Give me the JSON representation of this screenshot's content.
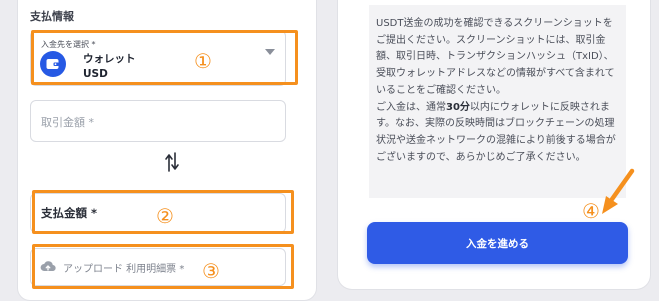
{
  "payment": {
    "section_title": "支払情報",
    "deposit_destination": {
      "caption": "入金先を選択 *",
      "wallet_name": "ウォレット",
      "currency": "USD"
    },
    "trade_amount_placeholder": "取引金額 *",
    "payment_amount_label": "支払金額 *",
    "upload_label": "アップロード 利用明細票 *"
  },
  "annotations": {
    "marker_1": "①",
    "marker_2": "②",
    "marker_3": "③",
    "marker_4": "④",
    "highlight_color": "#f5901e"
  },
  "notice": {
    "paragraph_1": "USDT送金の成功を確認できるスクリーンショットをご提出ください。スクリーンショットには、取引金額、取引日時、トランザクションハッシュ（TxID）、受取ウォレットアドレスなどの情報がすべて含まれていることをご確認ください。",
    "paragraph_2_before": "ご入金は、通常",
    "paragraph_2_bold": "30分",
    "paragraph_2_after": "以内にウォレットに反映されます。なお、実際の反映時間はブロックチェーンの処理状況や送金ネットワークの混雑により前後する場合がございますので、あらかじめご了承ください。"
  },
  "submit_button_label": "入金を進める",
  "colors": {
    "accent": "#2f5be6",
    "wallet_icon_bg": "#2659e4"
  },
  "icons": {
    "wallet": "wallet-icon",
    "dropdown": "chevron-down-icon",
    "swap": "swap-vertical-icon",
    "upload": "cloud-upload-icon",
    "arrow": "arrow-down-left-icon"
  }
}
